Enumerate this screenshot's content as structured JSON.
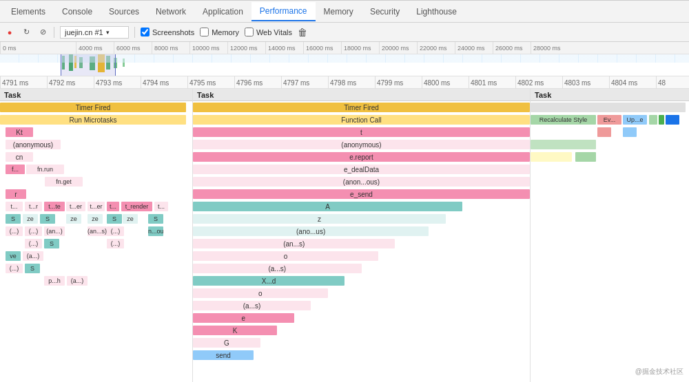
{
  "tabs": [
    {
      "label": "Elements",
      "active": false
    },
    {
      "label": "Console",
      "active": false
    },
    {
      "label": "Sources",
      "active": false
    },
    {
      "label": "Network",
      "active": false
    },
    {
      "label": "Application",
      "active": false
    },
    {
      "label": "Performance",
      "active": true
    },
    {
      "label": "Memory",
      "active": false
    },
    {
      "label": "Security",
      "active": false
    },
    {
      "label": "Lighthouse",
      "active": false
    }
  ],
  "toolbar": {
    "source": "juejin.cn #1",
    "screenshots_label": "Screenshots",
    "memory_label": "Memory",
    "web_vitals_label": "Web Vitals"
  },
  "overview_ruler_ticks": [
    "0 ms",
    "4000 ms",
    "6000 ms",
    "8000 ms",
    "10000 ms",
    "12000 ms",
    "14000 ms",
    "16000 ms",
    "18000 ms",
    "20000 ms",
    "22000 ms",
    "24000 ms",
    "26000 ms",
    "28000 ms"
  ],
  "detail_ruler_ticks": [
    "4791 ms",
    "4792 ms",
    "4793 ms",
    "4794 ms",
    "4795 ms",
    "4796 ms",
    "4797 ms",
    "4798 ms",
    "4799 ms",
    "4800 ms",
    "4801 ms",
    "4802 ms",
    "4803 ms",
    "4804 ms",
    "48"
  ],
  "sections": {
    "left": {
      "header": "Task",
      "rows": [
        "Timer Fired",
        "Run Microtasks",
        "  Kt",
        "  (anonymous)",
        "  cn",
        "  f...   fn.run",
        "         fn.get",
        "  r",
        "  t...  t...r  t...te",
        "  S    ze   S",
        "  (...)  (...)  (an...)",
        "         (...)  S",
        "  ve  (a...)",
        "  (...)  S",
        "         p...h",
        "         (a...)"
      ]
    },
    "mid": {
      "header": "Task",
      "rows": [
        "Timer Fired",
        "Function Call",
        "  t",
        "  (anonymous)",
        "  e.report",
        "  e_dealData",
        "  (anon...ous)",
        "  e_send",
        "  A",
        "  z",
        "  (ano...us)",
        "  (an...s)",
        "  o",
        "  (a...s)",
        "  X...d",
        "  o",
        "  (a...s)",
        "  e",
        "  K",
        "  G",
        "  send"
      ]
    },
    "right": {
      "header": "Task",
      "rows": [
        "Recalculate Style",
        "Ev...",
        "Up...e"
      ]
    }
  },
  "watermark": "@掘金技术社区"
}
